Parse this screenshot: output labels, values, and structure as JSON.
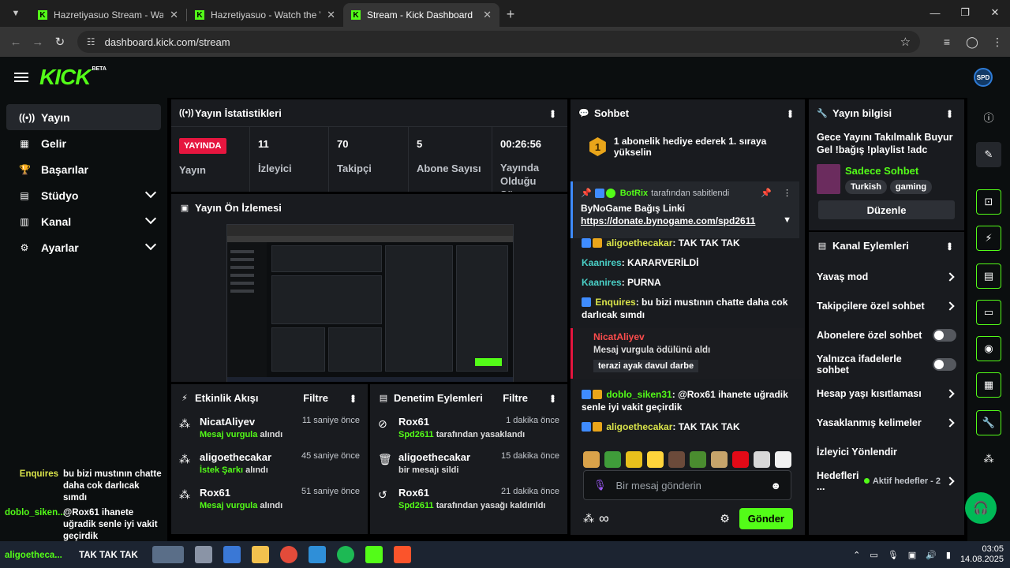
{
  "browser": {
    "tabs": [
      {
        "title": "Hazretiyasuo Stream - Watch Li",
        "active": false
      },
      {
        "title": "Hazretiyasuo - Watch the VOD",
        "active": false
      },
      {
        "title": "Stream - Kick Dashboard",
        "active": true
      }
    ],
    "address": "dashboard.kick.com/stream"
  },
  "header": {
    "logo": "KICK",
    "beta": "BETA",
    "avatar": "SPD"
  },
  "sidebar": {
    "items": [
      {
        "label": "Yayın",
        "icon": "broadcast-icon",
        "active": true,
        "chevron": false
      },
      {
        "label": "Gelir",
        "icon": "revenue-icon",
        "active": false,
        "chevron": false
      },
      {
        "label": "Başarılar",
        "icon": "trophy-icon",
        "active": false,
        "chevron": false
      },
      {
        "label": "Stüdyo",
        "icon": "studio-icon",
        "active": false,
        "chevron": true
      },
      {
        "label": "Kanal",
        "icon": "channel-icon",
        "active": false,
        "chevron": true
      },
      {
        "label": "Ayarlar",
        "icon": "gear-icon",
        "active": false,
        "chevron": true
      }
    ],
    "chat_overlay": [
      {
        "user": "Enquires",
        "message": "bu bizi mustının chatte daha cok darlıcak sımdı"
      },
      {
        "user": "doblo_siken...",
        "message": "@Rox61 ihanete uğradik senle iyi vakit geçirdik"
      }
    ]
  },
  "stats_panel": {
    "title": "Yayın İstatistikleri",
    "live_badge": "YAYINDA",
    "live_label": "Yayın",
    "stats": [
      {
        "value": "11",
        "label": "İzleyici"
      },
      {
        "value": "70",
        "label": "Takipçi"
      },
      {
        "value": "5",
        "label": "Abone Sayısı"
      },
      {
        "value": "00:26:56",
        "label": "Yayında Olduğu Süre"
      }
    ]
  },
  "preview_panel": {
    "title": "Yayın Ön İzlemesi"
  },
  "activity_panel": {
    "title": "Etkinlik Akışı",
    "filter": "Filtre",
    "items": [
      {
        "name": "NicatAliyev",
        "time": "11 saniye önce",
        "highlight": "Mesaj vurgula",
        "rest": " alındı"
      },
      {
        "name": "aligoethecakar",
        "time": "45 saniye önce",
        "highlight": "İstek Şarkı",
        "rest": " alındı"
      },
      {
        "name": "Rox61",
        "time": "51 saniye önce",
        "highlight": "Mesaj vurgula",
        "rest": " alındı"
      }
    ]
  },
  "moderation_panel": {
    "title": "Denetim Eylemleri",
    "filter": "Filtre",
    "items": [
      {
        "name": "Rox61",
        "time": "1 dakika önce",
        "highlight": "Spd2611",
        "rest": " tarafından yasaklandı",
        "icon": "ban-icon"
      },
      {
        "name": "aligoethecakar",
        "time": "15 dakika önce",
        "highlight": "",
        "rest": "bir mesajı sildi",
        "icon": "trash-icon"
      },
      {
        "name": "Rox61",
        "time": "21 dakika önce",
        "highlight": "Spd2611",
        "rest": " tarafından yasağı kaldırıldı",
        "icon": "undo-icon"
      }
    ]
  },
  "chat_panel": {
    "title": "Sohbet",
    "goal_rank": "1",
    "goal_text": "1 abonelik hediye ederek 1. sıraya yükselin",
    "pinned": {
      "user": "BotRix",
      "suffix": "tarafından sabitlendi",
      "title": "ByNoGame Bağış Linki",
      "link": "https://donate.bynogame.com/spd2611"
    },
    "messages": [
      {
        "user": "aligoethecakar",
        "text": "TAK TAK TAK"
      },
      {
        "user": "Kaanires",
        "text": "KARARVERİLDİ"
      },
      {
        "user": "Kaanires",
        "text": "PURNA"
      },
      {
        "user": "Enquires",
        "text": "bu bizi mustının chatte daha cok darlıcak sımdı"
      }
    ],
    "highlight": {
      "user": "NicatAliyev",
      "sub": "Mesaj vurgula ödülünü aldı",
      "tag": "terazi ayak davul darbe"
    },
    "messages2": [
      {
        "user": "doblo_siken31",
        "text": "@Rox61 ihanete uğradik senle iyi vakit geçirdik"
      },
      {
        "user": "aligoethecakar",
        "text": "TAK TAK TAK"
      }
    ],
    "input_placeholder": "Bir mesaj gönderin",
    "infinity": "∞",
    "send": "Gönder"
  },
  "info_panel": {
    "title": "Yayın bilgisi",
    "stream_title": "Gece Yayını Takılmalık Buyur Gel !bağış !playlist !adc",
    "category": "Sadece Sohbet",
    "tags": [
      "Turkish",
      "gaming"
    ],
    "edit": "Düzenle"
  },
  "channel_actions": {
    "title": "Kanal Eylemleri",
    "items": [
      {
        "label": "Yavaş mod",
        "kind": "chevron"
      },
      {
        "label": "Takipçilere özel sohbet",
        "kind": "chevron"
      },
      {
        "label": "Abonelere özel sohbet",
        "kind": "toggle"
      },
      {
        "label": "Yalnızca ifadelerle sohbet",
        "kind": "toggle"
      },
      {
        "label": "Hesap yaşı kısıtlaması",
        "kind": "chevron"
      },
      {
        "label": "Yasaklanmış kelimeler",
        "kind": "chevron"
      },
      {
        "label": "İzleyici Yönlendir",
        "kind": "none"
      },
      {
        "label": "Hedefleri ...",
        "kind": "goals",
        "sub": "Aktif hedefler - 2"
      }
    ]
  },
  "taskbar": {
    "overlay_user": "aligoetheca...",
    "overlay_text": "TAK TAK TAK",
    "time": "03:05",
    "date": "14.08.2025"
  },
  "colors": {
    "brand": "#53fc18",
    "live": "#e6163f",
    "panel": "#191b1f",
    "background": "#000000"
  }
}
